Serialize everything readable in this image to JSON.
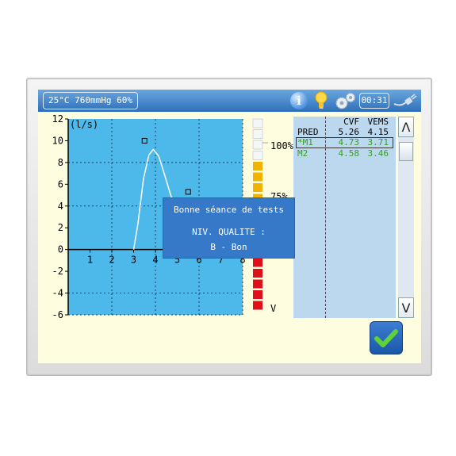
{
  "status_bar": {
    "environment": "25°C 760mmHg 60%",
    "timer": "00:31"
  },
  "icons": {
    "info": "i",
    "info_icon": "info-icon",
    "bulb_icon": "lightbulb-icon",
    "settings_icon": "gears-icon",
    "connection_icon": "plug-cable-icon"
  },
  "chart_data": {
    "type": "line",
    "ylabel": "(l/s)",
    "xlim": [
      0,
      8
    ],
    "ylim": [
      -6,
      12
    ],
    "x_ticks": [
      "1",
      "2",
      "3",
      "4",
      "5",
      "6",
      "7",
      "8"
    ],
    "y_ticks": [
      "12",
      "10",
      "8",
      "6",
      "4",
      "2",
      "0",
      "-2",
      "-4",
      "-6"
    ],
    "series": [
      {
        "points": [
          [
            3,
            0
          ],
          [
            3.2,
            2.4
          ],
          [
            3.45,
            6.5
          ],
          [
            3.7,
            8.7
          ],
          [
            3.9,
            9.2
          ],
          [
            4.15,
            8.6
          ],
          [
            4.4,
            7.0
          ],
          [
            4.7,
            5.0
          ],
          [
            5.0,
            3.5
          ],
          [
            5.2,
            3.0
          ]
        ]
      }
    ],
    "predicted_markers": [
      [
        3.5,
        10.0
      ],
      [
        5.5,
        5.3
      ]
    ],
    "color": "#ffffff",
    "plot_background": "#4db8ea"
  },
  "quality_gauge": {
    "labels": [
      "100%",
      "75%",
      "V"
    ],
    "fill_percent": 75
  },
  "results": {
    "headers": [
      "",
      "CVF",
      "VEMS"
    ],
    "rows": [
      {
        "label": "PRED",
        "cvf": "5.26",
        "vems": "4.15"
      },
      {
        "label": "*M1",
        "cvf": "4.73",
        "vems": "3.71"
      },
      {
        "label": "M2",
        "cvf": "4.58",
        "vems": "3.46"
      }
    ]
  },
  "scroll": {
    "up": "Λ",
    "down": "V"
  },
  "popup": {
    "title": "Bonne séance de tests",
    "quality_label": "NIV. QUALITE :",
    "quality_value": "B - Bon"
  },
  "confirm_icon": "checkmark-icon"
}
